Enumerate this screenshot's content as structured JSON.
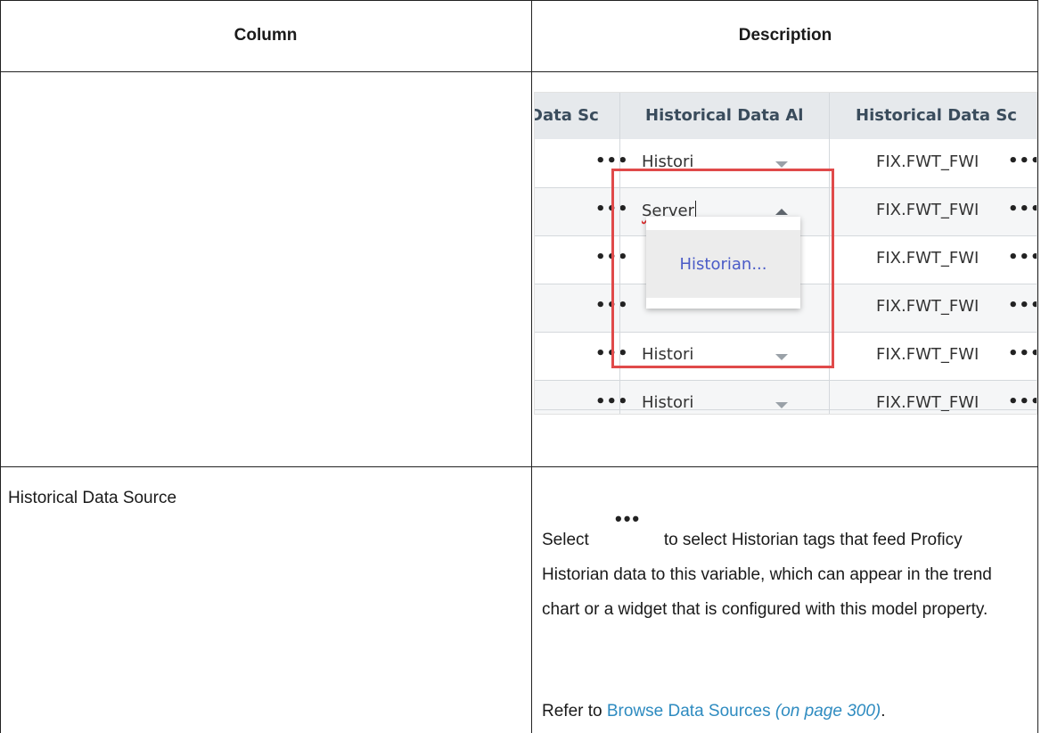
{
  "table": {
    "headers": {
      "column": "Column",
      "description": "Description"
    },
    "row2": {
      "column": "Historical Data Source",
      "select_word": "Select",
      "description_rest": "to select Historian tags that feed Proficy Historian data to this variable, which can appear in the trend chart or a widget that is configured with this model property.",
      "refer_prefix": "Refer to ",
      "refer_link": "Browse Data Sources",
      "refer_page": "(on page 300)",
      "refer_suffix": ".",
      "ellipsis_icon": "•••"
    }
  },
  "screenshot": {
    "columns": [
      "Data Sc",
      "Historical Data Al",
      "Historical Data Sc"
    ],
    "rows": [
      {
        "alias": "Histori",
        "source": "FIX.FWT_FWI",
        "more": "•••"
      },
      {
        "alias": "Server",
        "source": "FIX.FWT_FWI",
        "more": "•••"
      },
      {
        "alias": "",
        "source": "FIX.FWT_FWI",
        "more": "•••"
      },
      {
        "alias": "",
        "source": "FIX.FWT_FWI",
        "more": "•••"
      },
      {
        "alias": "Histori",
        "source": "FIX.FWT_FWI",
        "more": "•••"
      },
      {
        "alias": "Histori",
        "source": "FIX.FWT_FWI",
        "more": "•••"
      }
    ],
    "dropdown_option": "Historian...",
    "colors": {
      "highlight": "#e04a4a",
      "option_text": "#4a5bc7",
      "header_bg": "#e6e9ec",
      "link": "#2e8bc0"
    }
  }
}
